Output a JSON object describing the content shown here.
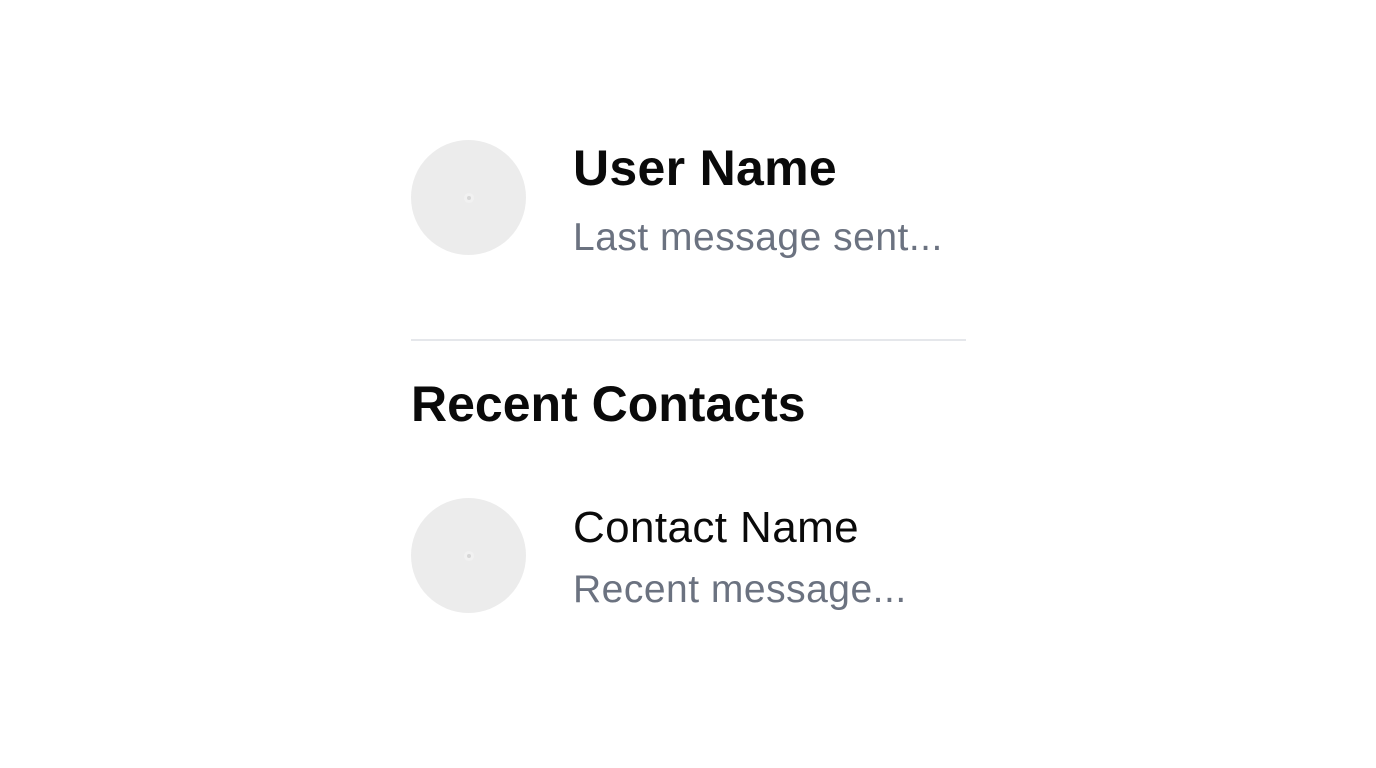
{
  "current_user": {
    "name": "User Name",
    "last_message": "Last message sent..."
  },
  "recent_contacts": {
    "title": "Recent Contacts",
    "items": [
      {
        "name": "Contact Name",
        "message": "Recent message..."
      }
    ]
  },
  "colors": {
    "avatar_placeholder": "#ececec",
    "secondary_text": "#6b7280",
    "divider": "#e5e7eb"
  }
}
